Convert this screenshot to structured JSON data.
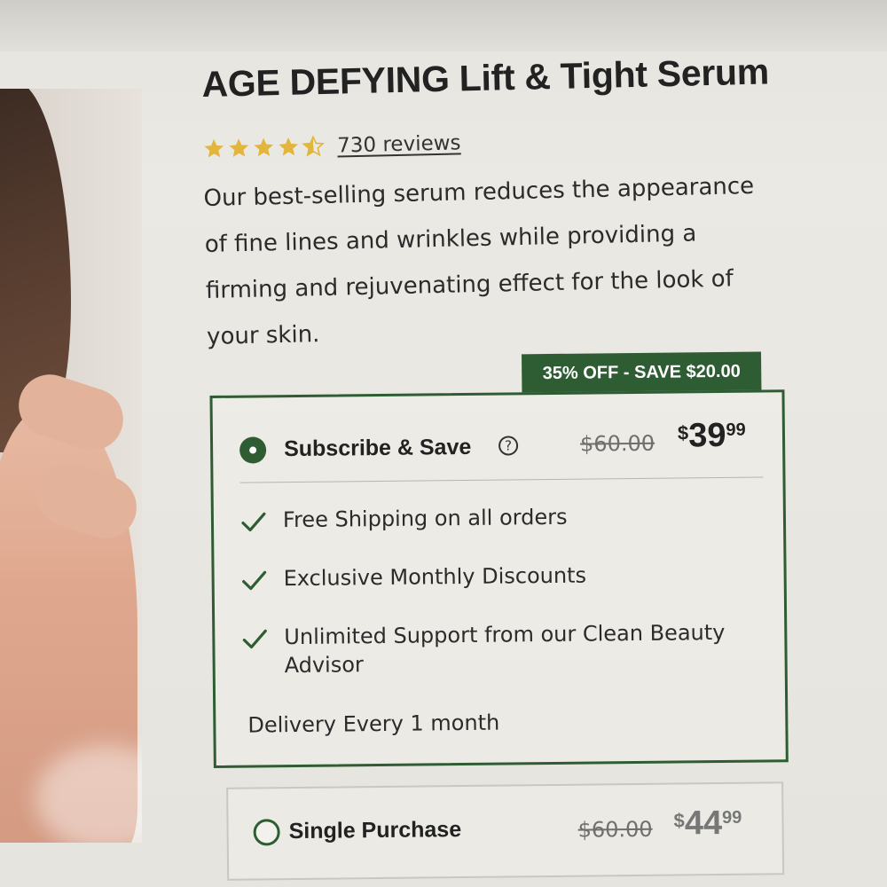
{
  "product": {
    "title": "AGE DEFYING Lift & Tight Serum",
    "rating": 4.5,
    "rating_max": 5,
    "reviews_label": "730 reviews",
    "description_lines": [
      "Our best-selling serum reduces the appearance",
      "of fine lines and wrinkles while providing a",
      "firming and rejuvenating effect for the look of",
      "your skin."
    ]
  },
  "colors": {
    "brand_green": "#2f5d33",
    "star_gold": "#e2b53c"
  },
  "subscribe_option": {
    "badge": "35% OFF - SAVE $20.00",
    "label": "Subscribe & Save",
    "help_icon": "?",
    "selected": true,
    "old_price": "$60.00",
    "price_symbol": "$",
    "price_int": "39",
    "price_dec": "99",
    "benefits": [
      {
        "icon": "check-icon",
        "text": "Free Shipping on all orders"
      },
      {
        "icon": "check-icon",
        "text": "Exclusive Monthly Discounts"
      },
      {
        "icon": "check-icon",
        "text": "Unlimited Support from our Clean Beauty Advisor"
      }
    ],
    "delivery": "Delivery Every 1 month"
  },
  "single_option": {
    "label": "Single Purchase",
    "selected": false,
    "old_price": "$60.00",
    "price_symbol": "$",
    "price_int": "44",
    "price_dec": "99"
  }
}
